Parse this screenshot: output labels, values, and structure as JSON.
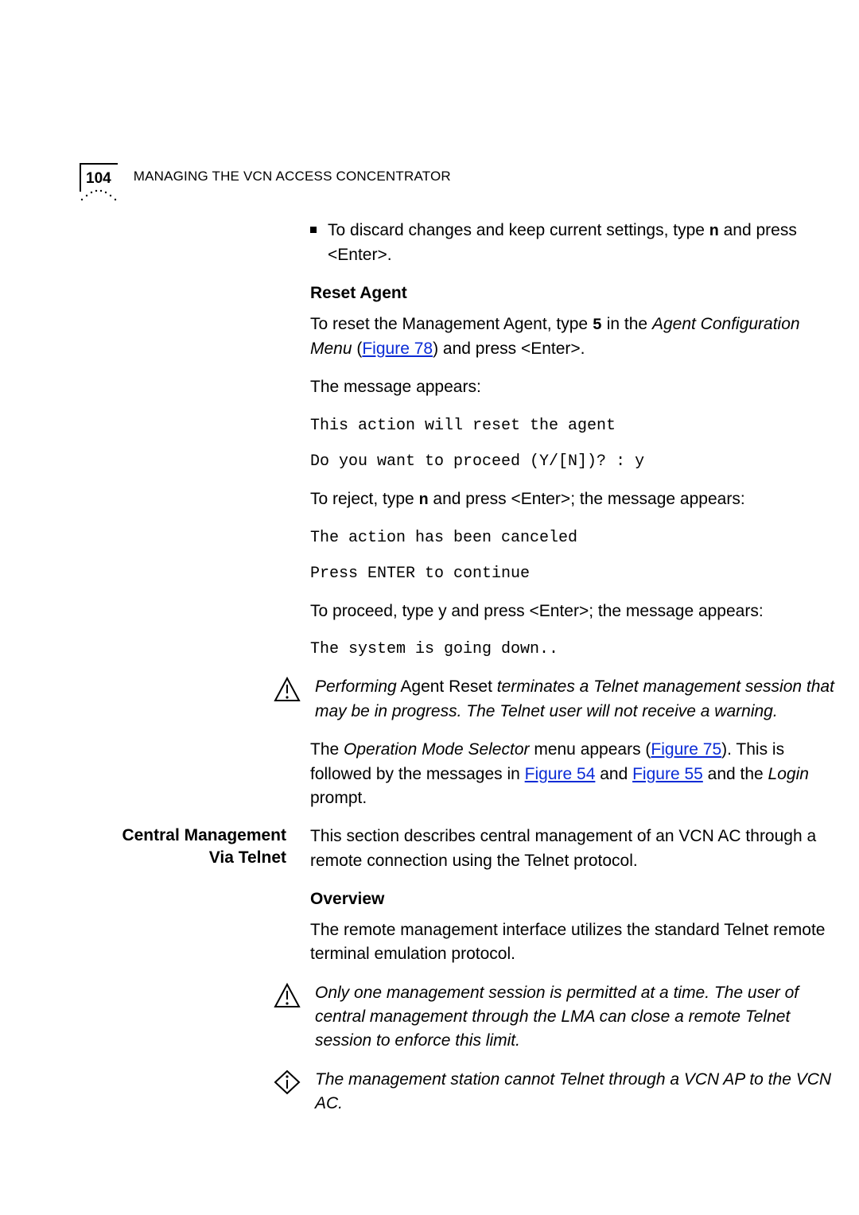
{
  "header": {
    "page_number": "104",
    "running_head_prefix": "M",
    "running_head_rest": "ANAGING THE VCN ACCESS CONCENTRATOR"
  },
  "bullet1": {
    "t1": "To discard changes and keep current settings, type ",
    "b1": "n",
    "t2": " and press <Enter>."
  },
  "reset": {
    "heading": "Reset Agent",
    "p1a": "To reset the Management Agent, type ",
    "p1b": "5",
    "p1c": " in the ",
    "p1d": "Agent Configuration Menu",
    "p1e": " (",
    "link1": "Figure 78",
    "p1f": ") and press <Enter>.",
    "msg_appears": "The message appears:",
    "mono1": "This action will reset the agent",
    "mono2": "Do you want to proceed (Y/[N])? : y",
    "reject_a": "To reject, type ",
    "reject_b": "n",
    "reject_c": " and press <Enter>; the message appears:",
    "mono3": "The action has been canceled",
    "mono4": "Press ENTER to continue",
    "proceed": "To proceed, type y and press <Enter>; the message appears:",
    "mono5": "The system is going down..",
    "warn_a": "Performing",
    "warn_b": " Agent Reset ",
    "warn_c": "terminates a Telnet management session that may be in progress. The Telnet user will not receive a warning.",
    "post_a": "The ",
    "post_b": "Operation Mode Selector",
    "post_c": " menu appears (",
    "link2": "Figure 75",
    "post_d": "). This is followed by the messages in ",
    "link3": "Figure 54",
    "post_e": " and ",
    "link4": "Figure 55",
    "post_f": " and the ",
    "post_g": "Login",
    "post_h": " prompt."
  },
  "central": {
    "side_label_l1": "Central Management",
    "side_label_l2": "Via Telnet",
    "intro": "This section describes central management of an VCN AC through a remote connection using the Telnet protocol.",
    "ov_heading": "Overview",
    "ov_para": "The remote management interface utilizes the standard Telnet remote terminal emulation protocol.",
    "warn": "Only one management session is permitted at a time. The user of central management through the LMA can close a remote Telnet session to enforce this limit.",
    "info": "The management station cannot Telnet through a VCN AP to the VCN AC."
  },
  "icons": {
    "warning": "warning-triangle-icon",
    "info": "info-diamond-icon"
  }
}
